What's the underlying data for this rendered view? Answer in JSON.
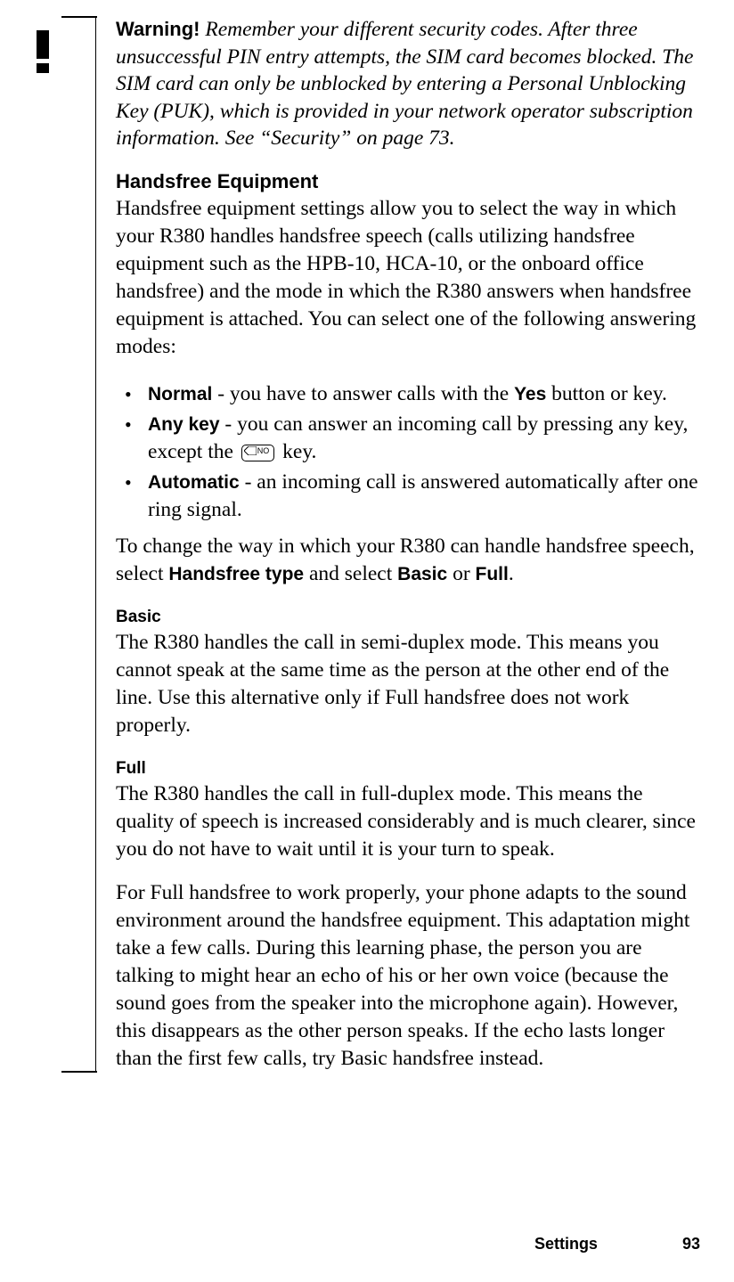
{
  "warning": {
    "label": "Warning!",
    "text": "Remember your different security codes. After three unsuccessful PIN entry attempts, the SIM card becomes blocked. The SIM card can only be unblocked by entering a Personal Unblocking Key (PUK), which is provided in your network operator subscription information. See “Security” on page 73."
  },
  "handsfree": {
    "heading": "Handsfree Equipment",
    "intro": "Handsfree equipment settings allow you to select the way in which your R380 handles handsfree speech (calls utilizing handsfree equipment such as the HPB-10, HCA-10, or the onboard office handsfree) and the mode in which the R380 answers when handsfree equipment is attached. You can select one of the following answering modes:",
    "bullets": {
      "normal": {
        "label": "Normal",
        "text_before": " - you have to answer calls with the ",
        "yes_label": "Yes",
        "text_after": " button or key."
      },
      "anykey": {
        "label": "Any key",
        "text_before": " - you can answer an incoming call by pressing any key, except the ",
        "no_key_label": "NO",
        "text_after": " key."
      },
      "automatic": {
        "label": "Automatic",
        "text": " - an incoming call is answered automatically after one ring signal."
      }
    },
    "change_text_before": "To change the way in which your R380 can handle handsfree speech, select ",
    "handsfree_type_label": "Handsfree type",
    "change_text_mid": " and select ",
    "basic_label": "Basic",
    "or_text": " or ",
    "full_label": "Full",
    "period": "."
  },
  "basic": {
    "heading": "Basic",
    "text": "The R380 handles the call in semi-duplex mode. This means you cannot speak at the same time as the person at the other end of the line. Use this alternative only if Full handsfree does not work properly."
  },
  "full": {
    "heading": "Full",
    "text1": "The R380 handles the call in full-duplex mode. This means the quality of speech is increased considerably and is much clearer, since you do not have to wait until it is your turn to speak.",
    "text2": "For Full handsfree to work properly, your phone adapts to the sound environment around the handsfree equipment. This adaptation might take a few calls. During this learning phase, the person you are talking to might hear an echo of his or her own voice (because the sound goes from the speaker into the microphone again). However, this disappears as the other person speaks. If the echo lasts longer than the first few calls, try Basic handsfree instead."
  },
  "footer": {
    "section": "Settings",
    "page": "93"
  }
}
